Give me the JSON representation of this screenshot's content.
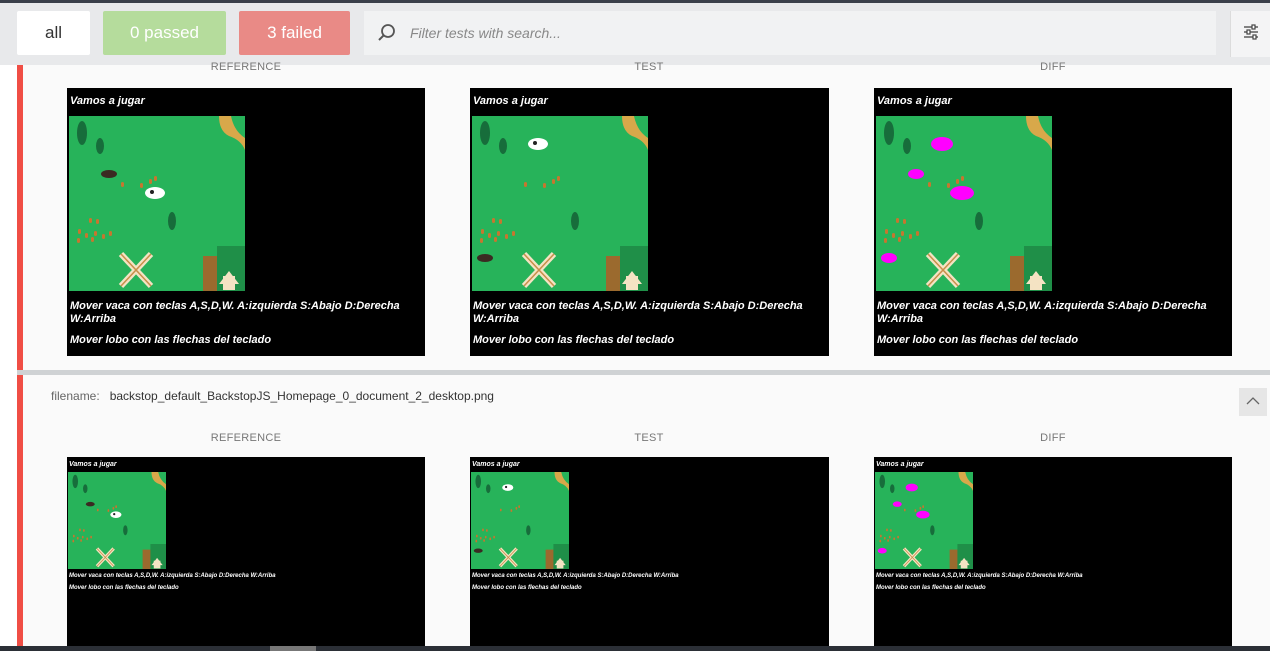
{
  "filters": {
    "all_label": "all",
    "passed_label": "0 passed",
    "failed_label": "3 failed"
  },
  "search": {
    "placeholder": "Filter tests with search..."
  },
  "icons": {
    "search": "search-icon",
    "settings": "sliders-icon",
    "collapse": "chevron-up-icon"
  },
  "colors": {
    "passed": "#b5dc9c",
    "failed": "#e98a86",
    "fail_marker": "#f04e45",
    "diff_highlight": "#ff00ff",
    "game_green": "#27b35a"
  },
  "columns": {
    "reference": "REFERENCE",
    "test": "TEST",
    "diff": "DIFF"
  },
  "game": {
    "title": "Vamos a jugar",
    "instructions": "Mover vaca con teclas A,S,D,W. A:izquierda S:Abajo D:Derecha W:Arriba",
    "wolf_instructions": "Mover lobo con las flechas del teclado"
  },
  "tests": [
    {
      "filename": ""
    },
    {
      "filename_label": "filename:",
      "filename": "backstop_default_BackstopJS_Homepage_0_document_2_desktop.png"
    }
  ]
}
